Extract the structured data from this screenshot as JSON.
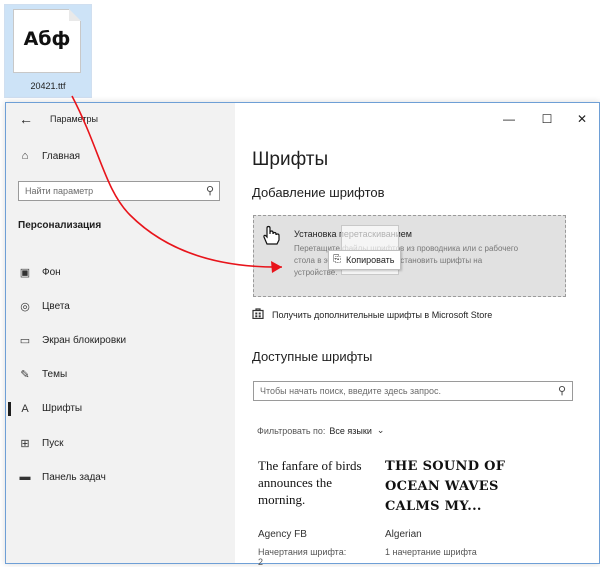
{
  "desktop_file": {
    "glyph": "Абф",
    "name": "20421.ttf"
  },
  "window": {
    "back_glyph": "←",
    "title": "Параметры",
    "minimize_glyph": "—",
    "maximize_glyph": "☐",
    "close_glyph": "✕"
  },
  "sidebar": {
    "home": {
      "icon": "⌂",
      "label": "Главная"
    },
    "search": {
      "placeholder": "Найти параметр",
      "icon": "⚲"
    },
    "section_title": "Персонализация",
    "items": [
      {
        "icon": "▣",
        "label": "Фон"
      },
      {
        "icon": "◎",
        "label": "Цвета"
      },
      {
        "icon": "▭",
        "label": "Экран блокировки"
      },
      {
        "icon": "✎",
        "label": "Темы"
      },
      {
        "icon": "A",
        "label": "Шрифты",
        "active": true
      },
      {
        "icon": "⊞",
        "label": "Пуск"
      },
      {
        "icon": "▬",
        "label": "Панель задач"
      }
    ]
  },
  "main": {
    "title": "Шрифты",
    "add_heading": "Добавление шрифтов",
    "drop_zone": {
      "title": "Установка перетаскиванием",
      "description_lines": [
        "Перетащите файлы шрифтов из проводника или с рабочего",
        "стола в эту область, чтобы установить шрифты на",
        "устройстве."
      ],
      "copy_label": "Копировать"
    },
    "store_link": "Получить дополнительные шрифты в Microsoft Store",
    "available_heading": "Доступные шрифты",
    "font_search_placeholder": "Чтобы начать поиск, введите здесь запрос.",
    "filter_label": "Фильтровать по:",
    "filter_value": "Все языки",
    "fonts": [
      {
        "sample": "The fanfare of birds announces the morning.",
        "name": "Agency FB",
        "styles": "Начертания шрифта:",
        "styles_extra": "2"
      },
      {
        "sample": "THE SOUND OF OCEAN WAVES CALMS MY...",
        "name": "Algerian",
        "styles": "1 начертание шрифта"
      }
    ]
  },
  "colors": {
    "arrow": "#e8141b",
    "window_border": "#6e9fd6",
    "sidebar_bg": "#f2f2f2"
  }
}
